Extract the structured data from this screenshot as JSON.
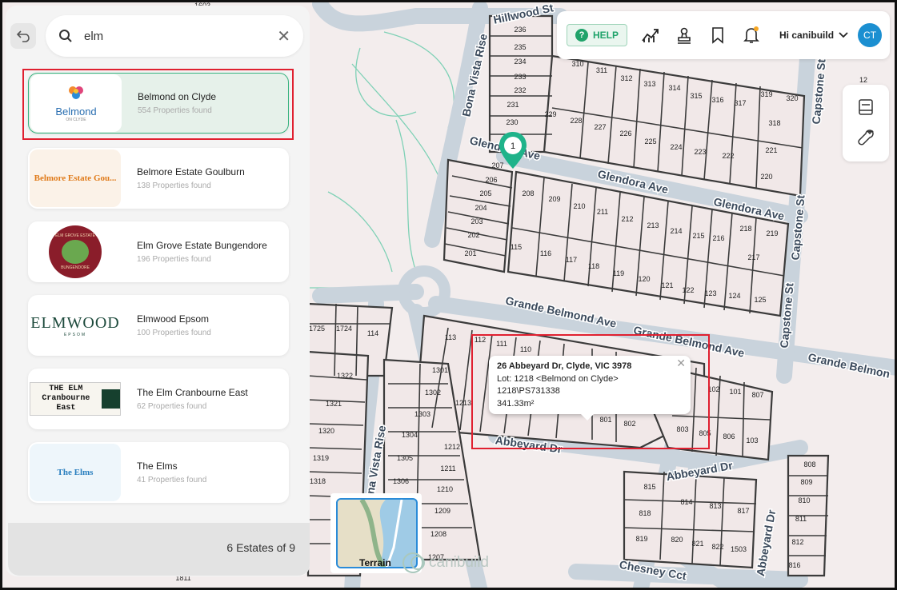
{
  "search": {
    "query": "elm"
  },
  "results": [
    {
      "name": "Belmond on Clyde",
      "count": "554 Properties found",
      "logo": "Belmond",
      "logo_sub": "ON CLYDE"
    },
    {
      "name": "Belmore Estate Goulburn",
      "count": "138 Properties found",
      "logo": "Belmore Estate Gou..."
    },
    {
      "name": "Elm Grove Estate Bungendore",
      "count": "196 Properties found",
      "logo": "ELM GROVE ESTATE",
      "logo_sub": "BUNGENDORE"
    },
    {
      "name": "Elmwood Epsom",
      "count": "100 Properties found",
      "logo": "ELMWOOD",
      "logo_sub": "EPSOM"
    },
    {
      "name": "The Elm Cranbourne East",
      "count": "62 Properties found",
      "logo": "THE ELM",
      "logo_sub": "Cranbourne East"
    },
    {
      "name": "The Elms",
      "count": "41 Properties found",
      "logo": "The Elms"
    }
  ],
  "footer": {
    "estates_count": "6 Estates of 9"
  },
  "topbar": {
    "help": "HELP",
    "greeting": "Hi canibuild",
    "avatar": "CT"
  },
  "popup": {
    "address": "26 Abbeyard Dr, Clyde, VIC 3978",
    "lot": "Lot: 1218 <Belmond on Clyde>",
    "plan": "1218\\PS731338",
    "area": "341.33m²"
  },
  "pin": {
    "label": "1"
  },
  "terrain": {
    "label": "Terrain"
  },
  "brand": {
    "name": "canibuild"
  },
  "map": {
    "roads": [
      "Hillwood St",
      "Bona Vista Rise",
      "Glendora Ave",
      "Glendora Ave",
      "Glendora Ave",
      "Grande Belmond Ave",
      "Grande Belmond Ave",
      "Grande Belmon",
      "Capstone St",
      "Capstone St",
      "Capstone St",
      "Abbeyard Dr",
      "Abbeyard Dr",
      "Abbeyard Dr",
      "Chesney Cct",
      "Bona Vista Rise"
    ],
    "lots": [
      "236",
      "235",
      "234",
      "233",
      "232",
      "231",
      "230",
      "310",
      "311",
      "312",
      "313",
      "314",
      "315",
      "316",
      "317",
      "319",
      "320",
      "229",
      "228",
      "227",
      "226",
      "225",
      "224",
      "223",
      "222",
      "221",
      "220",
      "318",
      "207",
      "206",
      "205",
      "204",
      "203",
      "202",
      "201",
      "208",
      "209",
      "210",
      "211",
      "212",
      "213",
      "214",
      "215",
      "216",
      "218",
      "219",
      "217",
      "115",
      "116",
      "117",
      "118",
      "119",
      "120",
      "121",
      "122",
      "123",
      "124",
      "125",
      "113",
      "112",
      "111",
      "110",
      "1301",
      "1302",
      "1303",
      "1304",
      "1305",
      "1306",
      "1213",
      "1212",
      "1211",
      "1210",
      "1209",
      "1208",
      "1207",
      "1725",
      "1724",
      "114",
      "1322",
      "1321",
      "1320",
      "1319",
      "1318",
      "1811",
      "801",
      "802",
      "803",
      "805",
      "806",
      "103",
      "102",
      "101",
      "807",
      "808",
      "809",
      "810",
      "811",
      "812",
      "816",
      "815",
      "814",
      "813",
      "817",
      "818",
      "819",
      "820",
      "821",
      "822",
      "1503",
      "1511",
      "1603",
      "12"
    ]
  }
}
